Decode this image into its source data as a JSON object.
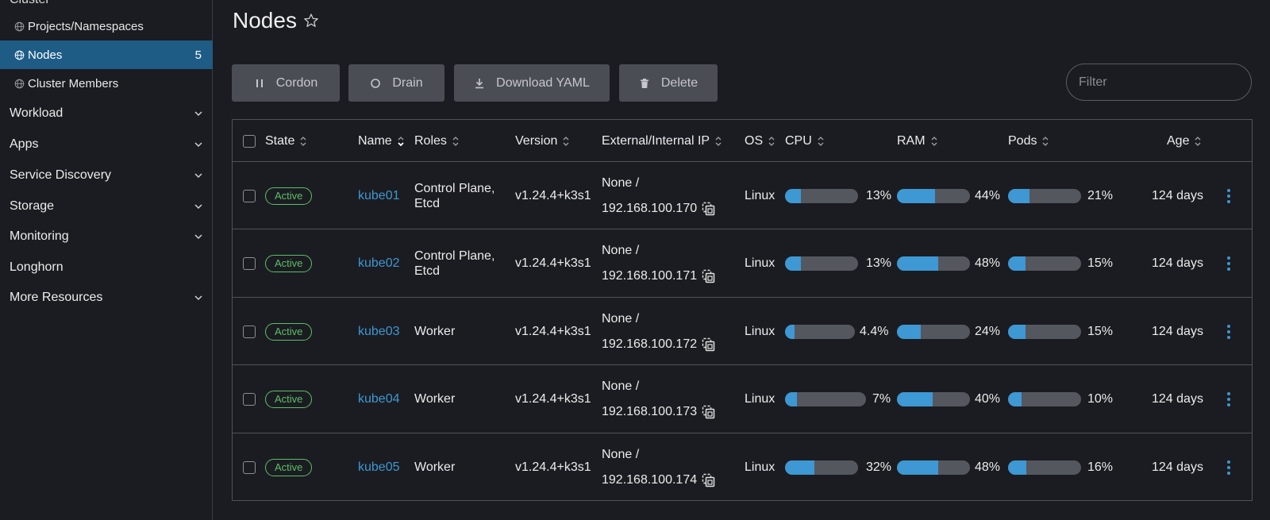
{
  "sidebar": {
    "cut_label": "Cluster",
    "sub_items": [
      {
        "label": "Projects/Namespaces",
        "count": ""
      },
      {
        "label": "Nodes",
        "count": "5"
      },
      {
        "label": "Cluster Members",
        "count": ""
      }
    ],
    "groups": [
      {
        "label": "Workload",
        "has_chevron": true
      },
      {
        "label": "Apps",
        "has_chevron": true
      },
      {
        "label": "Service Discovery",
        "has_chevron": true
      },
      {
        "label": "Storage",
        "has_chevron": true
      },
      {
        "label": "Monitoring",
        "has_chevron": true
      },
      {
        "label": "Longhorn",
        "has_chevron": false
      },
      {
        "label": "More Resources",
        "has_chevron": true
      }
    ]
  },
  "page": {
    "title": "Nodes",
    "star_icon": "star-outline-icon"
  },
  "toolbar": {
    "cordon": "Cordon",
    "drain": "Drain",
    "download": "Download YAML",
    "delete": "Delete",
    "filter_placeholder": "Filter"
  },
  "table": {
    "headers": {
      "state": "State",
      "name": "Name",
      "roles": "Roles",
      "version": "Version",
      "ip": "External/Internal IP",
      "os": "OS",
      "cpu": "CPU",
      "ram": "RAM",
      "pods": "Pods",
      "age": "Age"
    },
    "rows": [
      {
        "state": "Active",
        "name": "kube01",
        "roles_line1": "Control Plane,",
        "roles_line2": "Etcd",
        "version": "v1.24.4+k3s1",
        "ip_external": "None /",
        "ip_internal": "192.168.100.170",
        "os": "Linux",
        "cpu": "13%",
        "cpu_value": 13,
        "ram": "44%",
        "ram_value": 44,
        "pods": "21%",
        "pods_value": 21,
        "age": "124 days"
      },
      {
        "state": "Active",
        "name": "kube02",
        "roles_line1": "Control Plane,",
        "roles_line2": "Etcd",
        "version": "v1.24.4+k3s1",
        "ip_external": "None /",
        "ip_internal": "192.168.100.171",
        "os": "Linux",
        "cpu": "13%",
        "cpu_value": 13,
        "ram": "48%",
        "ram_value": 48,
        "pods": "15%",
        "pods_value": 15,
        "age": "124 days"
      },
      {
        "state": "Active",
        "name": "kube03",
        "roles_line1": "Worker",
        "roles_line2": "",
        "version": "v1.24.4+k3s1",
        "ip_external": "None /",
        "ip_internal": "192.168.100.172",
        "os": "Linux",
        "cpu": "4.4%",
        "cpu_value": 4.4,
        "ram": "24%",
        "ram_value": 24,
        "pods": "15%",
        "pods_value": 15,
        "age": "124 days"
      },
      {
        "state": "Active",
        "name": "kube04",
        "roles_line1": "Worker",
        "roles_line2": "",
        "version": "v1.24.4+k3s1",
        "ip_external": "None /",
        "ip_internal": "192.168.100.173",
        "os": "Linux",
        "cpu": "7%",
        "cpu_value": 7,
        "ram": "40%",
        "ram_value": 40,
        "pods": "10%",
        "pods_value": 10,
        "age": "124 days"
      },
      {
        "state": "Active",
        "name": "kube05",
        "roles_line1": "Worker",
        "roles_line2": "",
        "version": "v1.24.4+k3s1",
        "ip_external": "None /",
        "ip_internal": "192.168.100.174",
        "os": "Linux",
        "cpu": "32%",
        "cpu_value": 32,
        "ram": "48%",
        "ram_value": 48,
        "pods": "16%",
        "pods_value": 16,
        "age": "124 days"
      }
    ]
  },
  "colors": {
    "accent": "#3d98d3",
    "active_badge": "#5bbf68",
    "sidebar_active": "#1e5c86",
    "background": "#1b1c21"
  }
}
